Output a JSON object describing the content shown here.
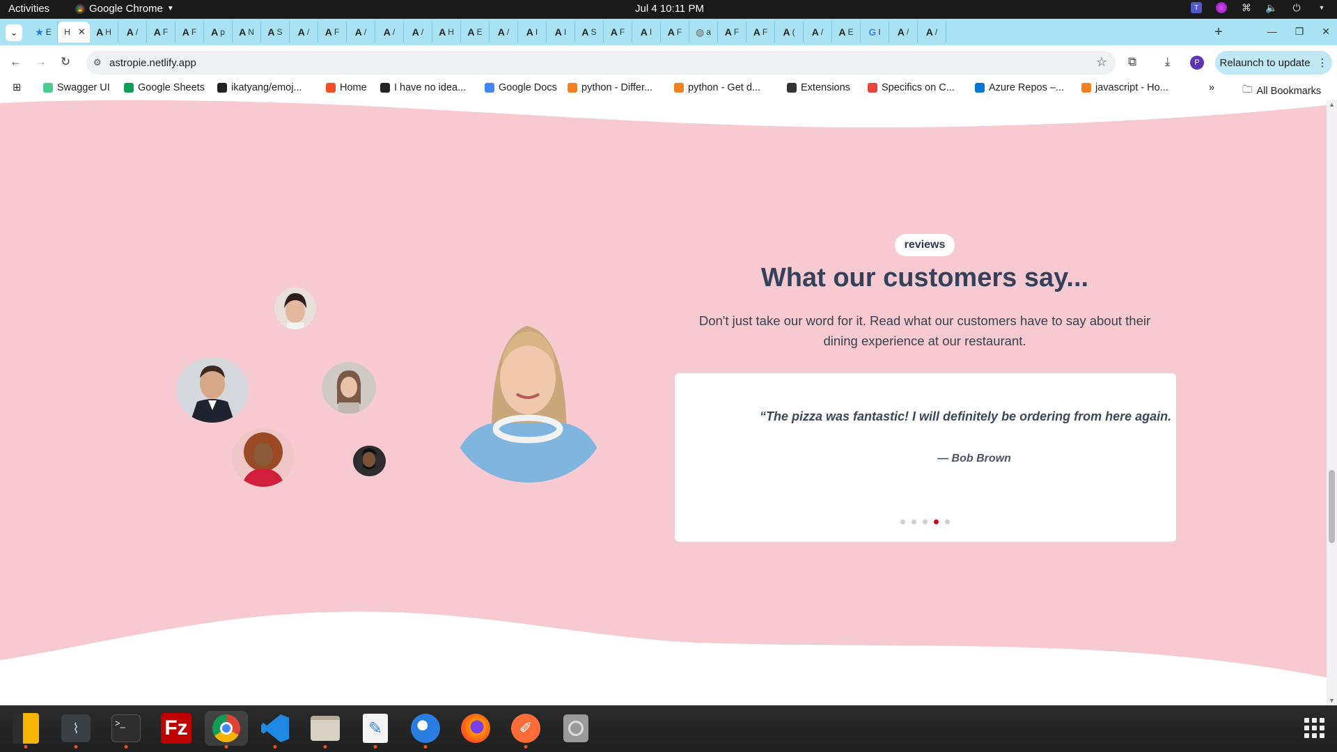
{
  "topbar": {
    "activities": "Activities",
    "app_name": "Google Chrome",
    "clock": "Jul 4  10:11 PM"
  },
  "browser": {
    "tabs": [
      {
        "icon": "star",
        "label": "E"
      },
      {
        "icon": "page",
        "label": "H",
        "active": true
      },
      {
        "icon": "A",
        "label": "H"
      },
      {
        "icon": "A",
        "label": "/"
      },
      {
        "icon": "A",
        "label": "F"
      },
      {
        "icon": "A",
        "label": "F"
      },
      {
        "icon": "A",
        "label": "p"
      },
      {
        "icon": "A",
        "label": "N"
      },
      {
        "icon": "A",
        "label": "S"
      },
      {
        "icon": "A",
        "label": "/"
      },
      {
        "icon": "A",
        "label": "F"
      },
      {
        "icon": "A",
        "label": "/"
      },
      {
        "icon": "A",
        "label": "/"
      },
      {
        "icon": "A",
        "label": "/"
      },
      {
        "icon": "A",
        "label": "H"
      },
      {
        "icon": "A",
        "label": "E"
      },
      {
        "icon": "A",
        "label": "/"
      },
      {
        "icon": "A",
        "label": "I"
      },
      {
        "icon": "A",
        "label": "I"
      },
      {
        "icon": "A",
        "label": "S"
      },
      {
        "icon": "A",
        "label": "F"
      },
      {
        "icon": "A",
        "label": "I"
      },
      {
        "icon": "A",
        "label": "F"
      },
      {
        "icon": "globe",
        "label": "a"
      },
      {
        "icon": "A",
        "label": "F"
      },
      {
        "icon": "A",
        "label": "F"
      },
      {
        "icon": "A",
        "label": "("
      },
      {
        "icon": "A",
        "label": "/"
      },
      {
        "icon": "A",
        "label": "E"
      },
      {
        "icon": "G",
        "label": "I"
      },
      {
        "icon": "A",
        "label": "/"
      },
      {
        "icon": "A",
        "label": "/"
      }
    ],
    "new_tab": "+",
    "url": "astropie.netlify.app",
    "relaunch_label": "Relaunch to update",
    "profile_initial": "P",
    "bookmarks": [
      {
        "label": "Swagger UI",
        "color": "#49cc90"
      },
      {
        "label": "Google Sheets",
        "color": "#0f9d58"
      },
      {
        "label": "ikatyang/emoj...",
        "color": "#222222"
      },
      {
        "label": "Home",
        "color": "#f25022"
      },
      {
        "label": "I have no idea...",
        "color": "#222222"
      },
      {
        "label": "Google Docs",
        "color": "#4285f4"
      },
      {
        "label": "python - Differ...",
        "color": "#f48024"
      },
      {
        "label": "python - Get d...",
        "color": "#f48024"
      },
      {
        "label": "Extensions",
        "color": "#333333"
      },
      {
        "label": "Specifics on C...",
        "color": "#e8453c"
      },
      {
        "label": "Azure Repos –...",
        "color": "#0078d4"
      },
      {
        "label": "javascript - Ho...",
        "color": "#f48024"
      }
    ],
    "all_bookmarks": "All Bookmarks"
  },
  "page": {
    "bg_color": "#f7c9d0",
    "badge": "reviews",
    "heading": "What our customers say...",
    "subtext_line1": "Don't just take our word for it. Read what our customers have to say about their",
    "subtext_line2": "dining experience at our restaurant.",
    "review": {
      "quote": "“The pizza was fantastic! I will definitely be ordering from here again.",
      "author": "— Bob Brown"
    },
    "carousel": {
      "count": 5,
      "active_index": 3,
      "active_color": "#d0021b"
    }
  },
  "dock": {
    "apps": [
      "notes-app-icon",
      "system-monitor-icon",
      "terminal-icon",
      "filezilla-icon",
      "chrome-icon",
      "vscode-icon",
      "files-icon",
      "text-editor-icon",
      "thunderbird-icon",
      "firefox-icon",
      "postman-icon",
      "disk-utility-icon"
    ]
  }
}
